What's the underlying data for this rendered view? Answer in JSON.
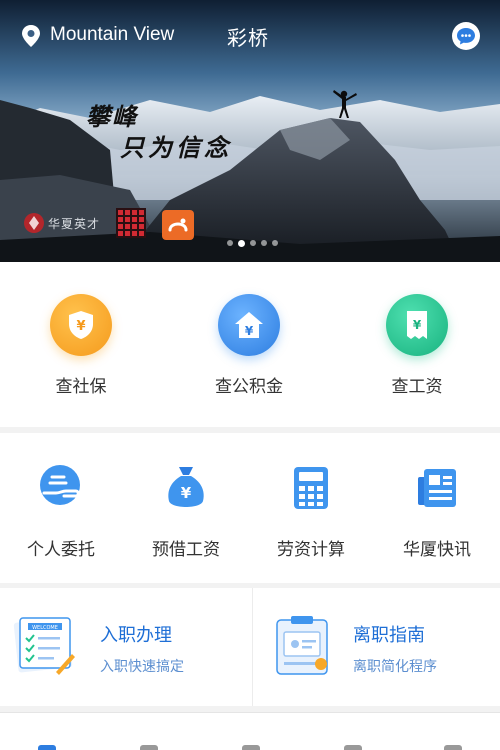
{
  "header": {
    "location": "Mountain View",
    "title": "彩桥"
  },
  "banner": {
    "slogan_line1": "攀峰",
    "slogan_line2": "只为信念",
    "partner_logo_text": "华夏英才",
    "carousel_pages": 5,
    "carousel_active": 2
  },
  "main_services": [
    {
      "label": "查社保",
      "icon": "shield-yen-icon",
      "color": "#f7a829"
    },
    {
      "label": "查公积金",
      "icon": "house-yen-icon",
      "color": "#3f95ee"
    },
    {
      "label": "查工资",
      "icon": "receipt-yen-icon",
      "color": "#22c38e"
    }
  ],
  "tools": [
    {
      "label": "个人委托",
      "icon": "hand-icon"
    },
    {
      "label": "预借工资",
      "icon": "money-bag-icon"
    },
    {
      "label": "劳资计算",
      "icon": "calculator-icon"
    },
    {
      "label": "华厦快讯",
      "icon": "news-icon"
    }
  ],
  "cards": [
    {
      "title": "入职办理",
      "subtitle": "入职快速搞定",
      "icon": "onboarding-doc-icon",
      "doc_header": "WELCOME"
    },
    {
      "title": "离职指南",
      "subtitle": "离职简化程序",
      "icon": "clipboard-icon"
    }
  ],
  "colors": {
    "primary_blue": "#2d7de0",
    "orange": "#f7a829",
    "blue": "#3f95ee",
    "green": "#22c38e"
  }
}
